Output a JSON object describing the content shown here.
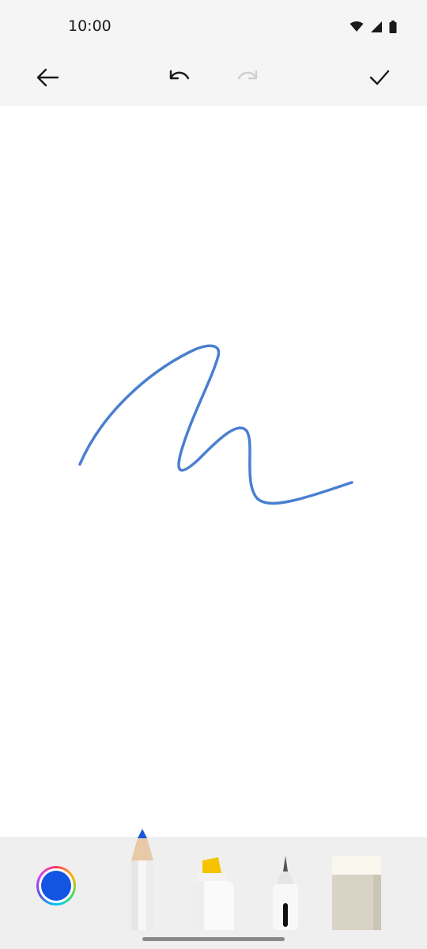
{
  "status_bar": {
    "time": "10:00",
    "icons": [
      "wifi-icon",
      "signal-icon",
      "battery-icon"
    ]
  },
  "toolbar": {
    "buttons": [
      {
        "name": "back",
        "icon": "arrow-left-icon"
      },
      {
        "name": "undo",
        "icon": "undo-icon",
        "enabled": true
      },
      {
        "name": "redo",
        "icon": "redo-icon",
        "enabled": false
      },
      {
        "name": "confirm",
        "icon": "check-icon"
      }
    ]
  },
  "canvas": {
    "stroke_color": "#4a7fd0"
  },
  "tools": {
    "selected_color": "#1354e3",
    "items": [
      {
        "name": "color-picker",
        "icon": "color-wheel-icon"
      },
      {
        "name": "pencil",
        "icon": "pencil-icon",
        "selected": true
      },
      {
        "name": "highlighter",
        "icon": "highlighter-icon"
      },
      {
        "name": "pen",
        "icon": "fountain-pen-icon"
      },
      {
        "name": "eraser",
        "icon": "eraser-icon"
      }
    ]
  }
}
